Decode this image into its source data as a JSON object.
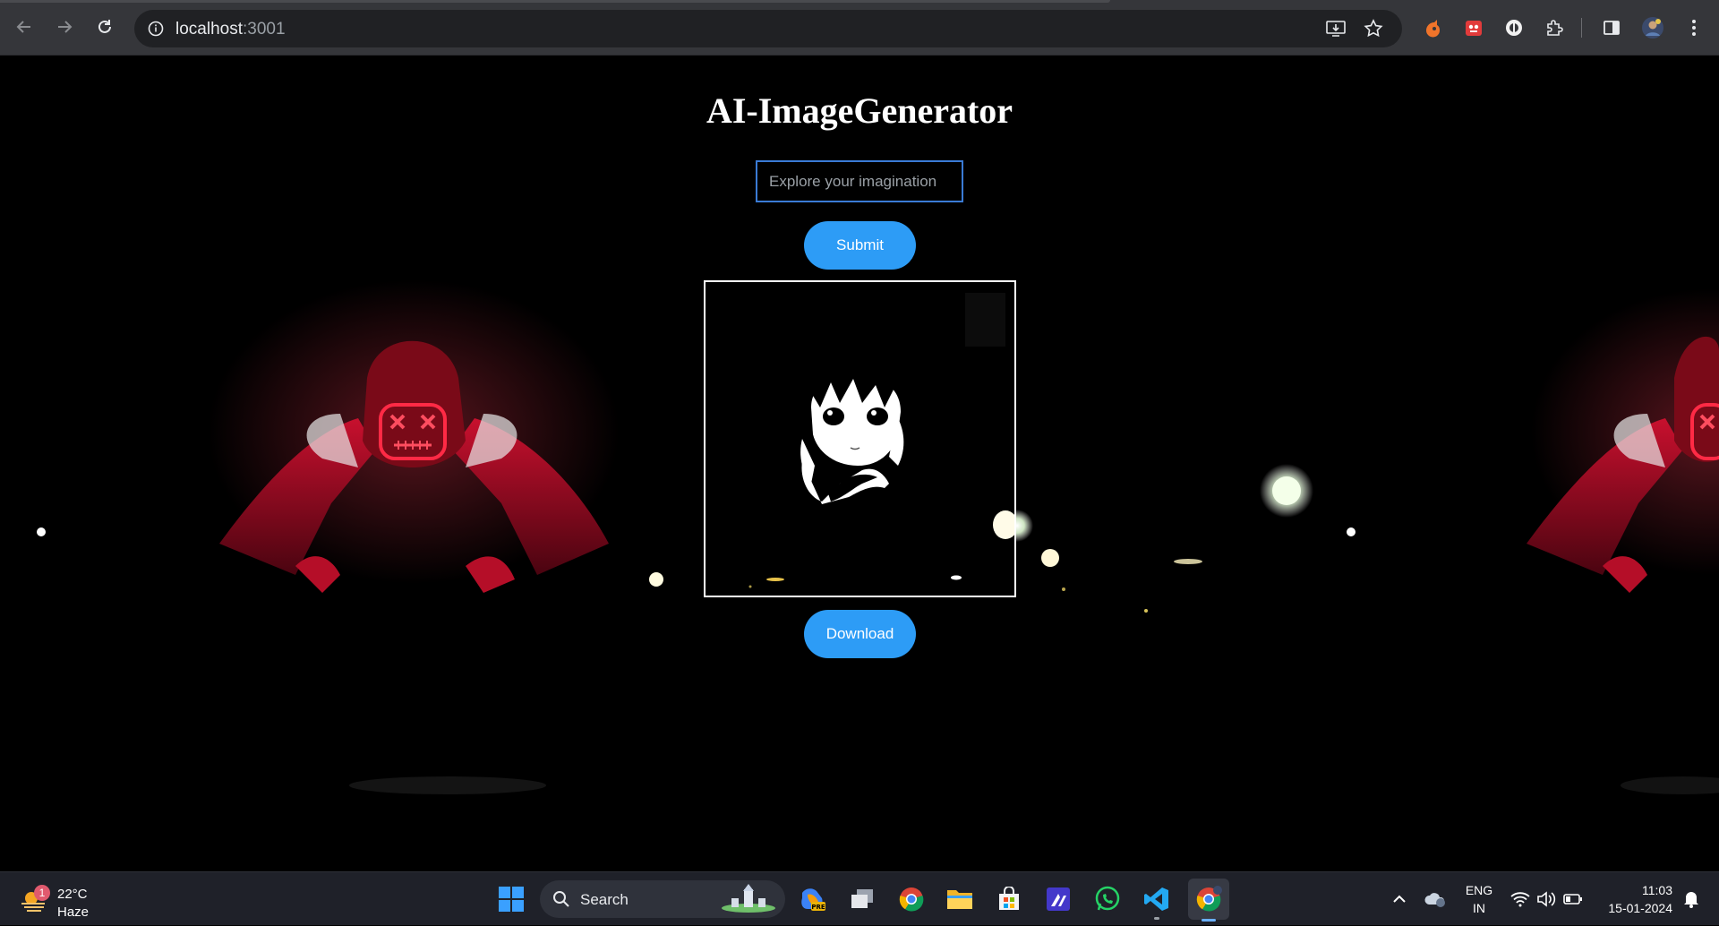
{
  "browser": {
    "url_host": "localhost",
    "url_port": ":3001",
    "icons": [
      "back-arrow-icon",
      "forward-arrow-icon",
      "reload-icon",
      "site-info-icon",
      "install-app-icon",
      "bookmark-star-icon",
      "extension-fox-icon",
      "extension-red-icon",
      "extension-circle-icon",
      "extensions-puzzle-icon",
      "side-panel-icon",
      "profile-avatar-icon",
      "more-menu-icon"
    ]
  },
  "page": {
    "title": "AI-ImageGenerator",
    "input_placeholder": "Explore your imagination",
    "input_value": "",
    "submit_label": "Submit",
    "download_label": "Download",
    "accent_color": "#2d9cf6"
  },
  "taskbar": {
    "weather": {
      "badge": "1",
      "temperature": "22°C",
      "condition": "Haze"
    },
    "search_label": "Search",
    "apps": [
      "start-icon",
      "copilot-icon",
      "task-view-icon",
      "chrome-icon",
      "file-explorer-icon",
      "microsoft-store-icon",
      "code-editor-icon",
      "whatsapp-icon",
      "vscode-icon",
      "chrome-profile-icon"
    ],
    "language": {
      "line1": "ENG",
      "line2": "IN"
    },
    "time": "11:03",
    "date": "15-01-2024"
  }
}
